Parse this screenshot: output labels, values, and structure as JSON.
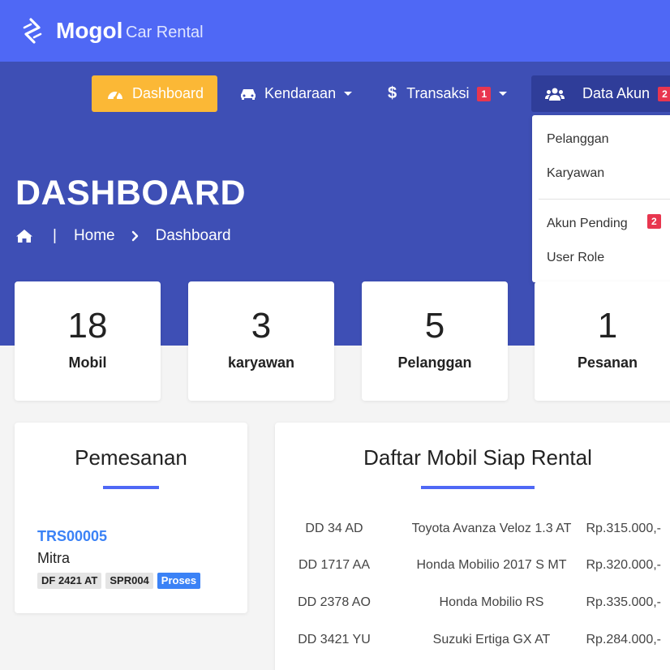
{
  "brand": {
    "name": "Mogol",
    "subtitle": "Car Rental"
  },
  "colors": {
    "topbar": "#4f68f5",
    "hero": "#3e4fb5",
    "active_nav": "#fbb836",
    "open_nav": "#2f3d99",
    "badge": "#e8364f",
    "link": "#3b82f6"
  },
  "nav": {
    "dashboard": {
      "label": "Dashboard",
      "icon": "gauge-icon",
      "active": true
    },
    "kendaraan": {
      "label": "Kendaraan",
      "icon": "car-icon"
    },
    "transaksi": {
      "label": "Transaksi",
      "icon": "dollar-icon",
      "badge": "1"
    },
    "data_akun": {
      "label": "Data Akun",
      "icon": "users-icon",
      "badge": "2",
      "open": true
    }
  },
  "dropdown": {
    "items": [
      {
        "label": "Pelanggan"
      },
      {
        "label": "Karyawan"
      },
      {
        "label": "Akun Pending",
        "badge": "2"
      },
      {
        "label": "User Role"
      }
    ]
  },
  "page": {
    "title": "DASHBOARD",
    "breadcrumb": {
      "separator": "|",
      "home": "Home",
      "current": "Dashboard"
    }
  },
  "stats": [
    {
      "value": "18",
      "label": "Mobil"
    },
    {
      "value": "3",
      "label": "karyawan"
    },
    {
      "value": "5",
      "label": "Pelanggan"
    },
    {
      "value": "1",
      "label": "Pesanan"
    }
  ],
  "pemesanan": {
    "title": "Pemesanan",
    "orders": [
      {
        "code": "TRS00005",
        "customer": "Mitra",
        "plate": "DF 2421 AT",
        "ref": "SPR004",
        "status": "Proses"
      }
    ]
  },
  "daftar_mobil": {
    "title": "Daftar Mobil Siap Rental",
    "rows": [
      {
        "plate": "DD 34 AD",
        "name": "Toyota Avanza Veloz 1.3 AT",
        "price": "Rp.315.000,-"
      },
      {
        "plate": "DD 1717 AA",
        "name": "Honda Mobilio 2017 S MT",
        "price": "Rp.320.000,-"
      },
      {
        "plate": "DD 2378 AO",
        "name": "Honda Mobilio RS",
        "price": "Rp.335.000,-"
      },
      {
        "plate": "DD 3421 YU",
        "name": "Suzuki Ertiga GX AT",
        "price": "Rp.284.000,-"
      }
    ]
  }
}
